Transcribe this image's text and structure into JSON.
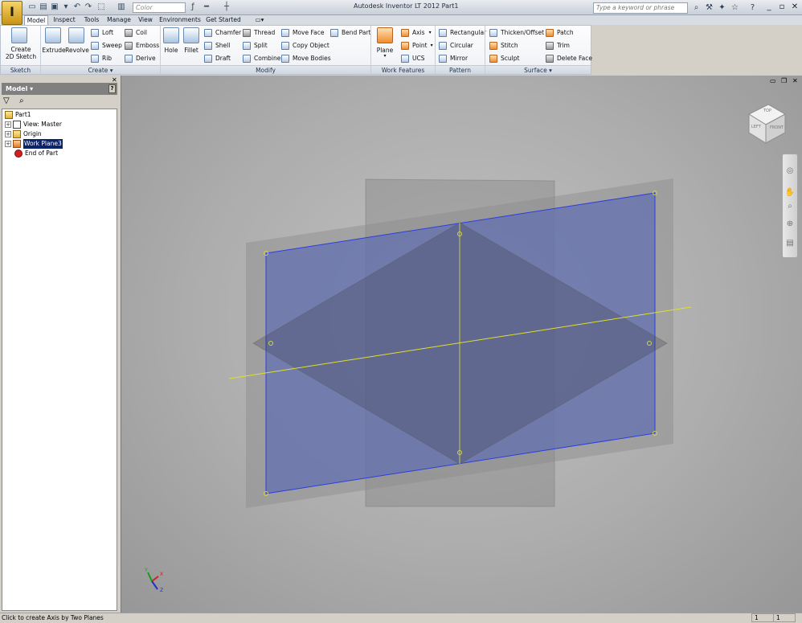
{
  "window": {
    "title": "Autodesk Inventor LT 2012    Part1",
    "app_logo": "I",
    "color_combo": "Color",
    "search_placeholder": "Type a keyword or phrase"
  },
  "tabs": [
    {
      "label": "Model",
      "active": true
    },
    {
      "label": "Inspect"
    },
    {
      "label": "Tools"
    },
    {
      "label": "Manage"
    },
    {
      "label": "View"
    },
    {
      "label": "Environments"
    },
    {
      "label": "Get Started"
    }
  ],
  "ribbon": {
    "sketch": {
      "title": "Sketch",
      "create_2d_sketch": "Create\n2D Sketch"
    },
    "create": {
      "title": "Create ▾",
      "extrude": "Extrude",
      "revolve": "Revolve",
      "loft": "Loft",
      "sweep": "Sweep",
      "rib": "Rib",
      "coil": "Coil",
      "emboss": "Emboss",
      "derive": "Derive"
    },
    "modify": {
      "title": "Modify",
      "hole": "Hole",
      "fillet": "Fillet",
      "chamfer": "Chamfer",
      "shell": "Shell",
      "draft": "Draft",
      "thread": "Thread",
      "split": "Split",
      "combine": "Combine",
      "move_face": "Move Face",
      "copy_object": "Copy Object",
      "move_bodies": "Move Bodies",
      "bend_part": "Bend Part"
    },
    "work_features": {
      "title": "Work Features",
      "plane": "Plane",
      "axis": "Axis",
      "point": "Point",
      "ucs": "UCS"
    },
    "pattern": {
      "title": "Pattern",
      "rectangular": "Rectangular",
      "circular": "Circular",
      "mirror": "Mirror"
    },
    "surface": {
      "title": "Surface ▾",
      "thicken_offset": "Thicken/Offset",
      "stitch": "Stitch",
      "sculpt": "Sculpt",
      "patch": "Patch",
      "trim": "Trim",
      "delete_face": "Delete Face"
    }
  },
  "browser": {
    "title": "Model ▾",
    "help": "?",
    "tree": [
      {
        "label": "Part1"
      },
      {
        "label": "View: Master",
        "expander": "+"
      },
      {
        "label": "Origin",
        "expander": "+"
      },
      {
        "label": "Work Plane3",
        "expander": "+",
        "selected": true
      },
      {
        "label": "End of Part"
      }
    ]
  },
  "viewcube": {
    "top": "TOP",
    "left": "LEFT",
    "front": "FRONT"
  },
  "triad": {
    "x": "X",
    "y": "Y",
    "z": "Z"
  },
  "status": {
    "message": "Click to create Axis by Two Planes",
    "cell1": "1",
    "cell2": "1"
  }
}
